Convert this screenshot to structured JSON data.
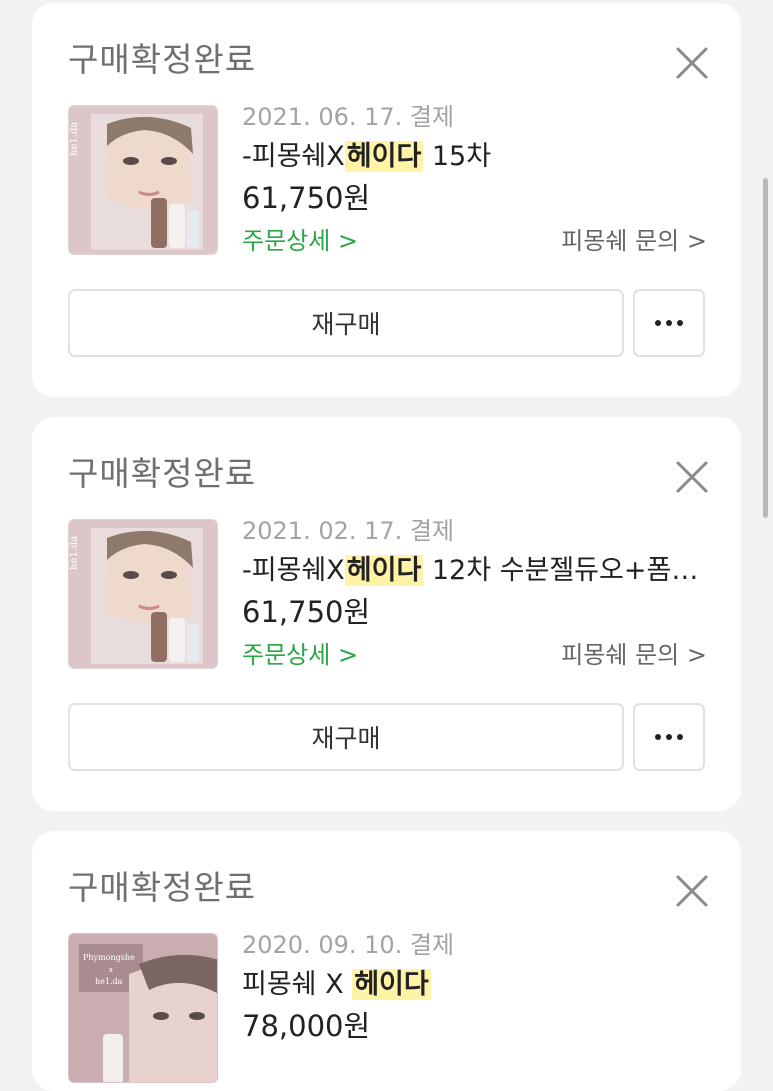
{
  "orders": [
    {
      "status": "구매확정완료",
      "date": "2021. 06. 17. 결제",
      "title_prefix": "-피몽쉐X",
      "title_highlight": "헤이다",
      "title_suffix": " 15차",
      "price": "61,750원",
      "detail_label": "주문상세 >",
      "inquiry_label": "피몽쉐 문의 >",
      "rebuy_label": "재구매",
      "thumbnail": "heida-product-image"
    },
    {
      "status": "구매확정완료",
      "date": "2021. 02. 17. 결제",
      "title_prefix": "-피몽쉐X",
      "title_highlight": "헤이다",
      "title_suffix": " 12차 수분젤듀오+폼…",
      "price": "61,750원",
      "detail_label": "주문상세 >",
      "inquiry_label": "피몽쉐 문의 >",
      "rebuy_label": "재구매",
      "thumbnail": "heida-product-image"
    },
    {
      "status": "구매확정완료",
      "date": "2020. 09. 10. 결제",
      "title_prefix": "피몽쉐 X ",
      "title_highlight": "헤이다",
      "title_suffix": "",
      "price": "78,000원",
      "thumbnail": "phymongshe-heida-image",
      "thumb_text_1": "Phymongshe",
      "thumb_text_2": "x",
      "thumb_text_3": "he1.da"
    }
  ],
  "colors": {
    "background": "#f2f2f4",
    "card": "#ffffff",
    "detail_link": "#2aa548",
    "highlight": "#fff3a8"
  },
  "icons": {
    "close": "close-icon",
    "more": "more-dots-icon"
  }
}
